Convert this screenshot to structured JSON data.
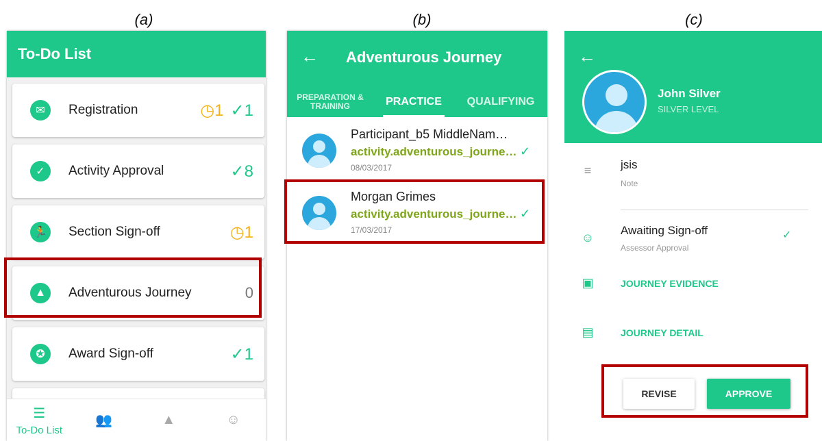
{
  "panel_labels": [
    "(a)",
    "(b)",
    "(c)"
  ],
  "panel_a": {
    "title": "To-Do List",
    "items": [
      {
        "label": "Registration",
        "icon": "envelope-icon",
        "pending": "1",
        "done": "1"
      },
      {
        "label": "Activity Approval",
        "icon": "check-circle-icon",
        "pending": "",
        "done": "8"
      },
      {
        "label": "Section Sign-off",
        "icon": "runner-icon",
        "pending": "1",
        "done": ""
      },
      {
        "label": "Adventurous Journey",
        "icon": "mountain-icon",
        "count": "0"
      },
      {
        "label": "Award Sign-off",
        "icon": "award-icon",
        "pending": "",
        "done": "1"
      }
    ],
    "nav": {
      "todo_label": "To-Do List"
    }
  },
  "panel_b": {
    "title": "Adventurous Journey",
    "tabs": [
      "PREPARATION & TRAINING",
      "PRACTICE",
      "QUALIFYING"
    ],
    "entries": [
      {
        "name": "Participant_b5 MiddleNam…",
        "activity": "activity.adventurous_journe…",
        "date": "08/03/2017"
      },
      {
        "name": "Morgan Grimes",
        "activity": "activity.adventurous_journe…",
        "date": "17/03/2017"
      }
    ]
  },
  "panel_c": {
    "name": "John  Silver",
    "level": "SILVER LEVEL",
    "note_text": "jsis",
    "note_label": "Note",
    "status_text": "Awaiting Sign-off",
    "status_label": "Assessor Approval",
    "journey_evidence": "JOURNEY EVIDENCE",
    "journey_detail": "JOURNEY DETAIL",
    "revise": "REVISE",
    "approve": "APPROVE"
  },
  "colors": {
    "accent": "#1ec88a",
    "pending": "#f4b21a",
    "activity": "#7fa61a",
    "highlight": "#b20000"
  }
}
